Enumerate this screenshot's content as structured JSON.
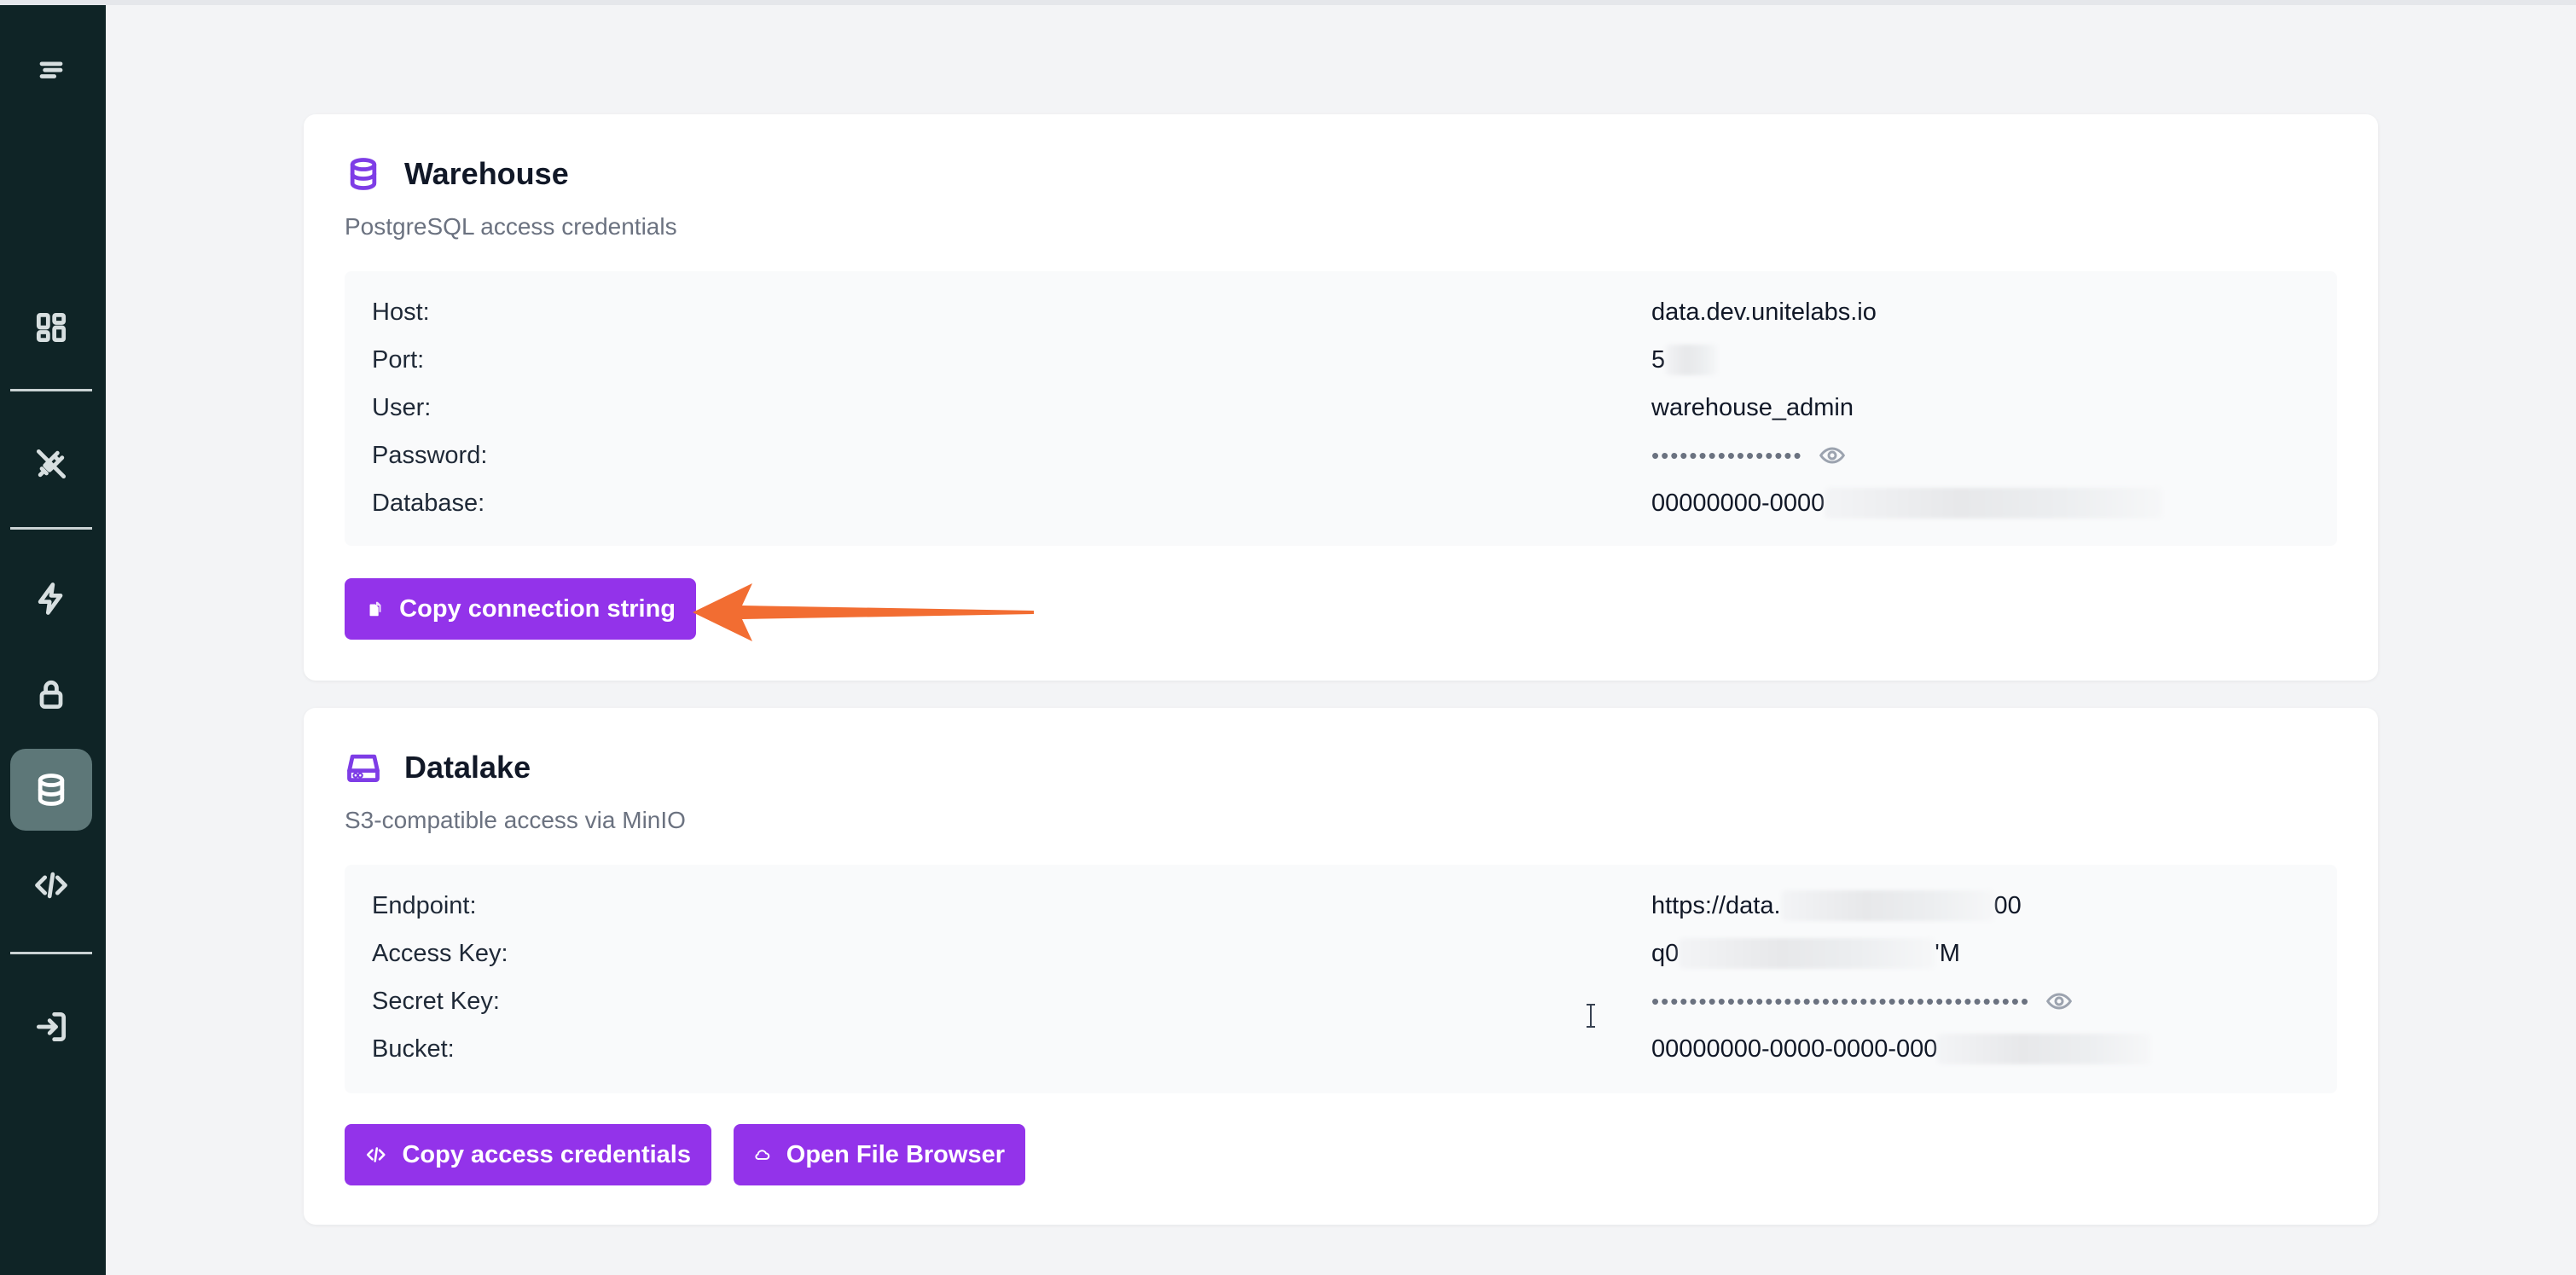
{
  "sidebar": {
    "items": [
      {
        "icon": "menu-icon"
      },
      {
        "icon": "dashboard-icon"
      },
      {
        "icon": "plug-icon"
      },
      {
        "icon": "lightning-icon"
      },
      {
        "icon": "lock-icon"
      },
      {
        "icon": "database-icon",
        "active": true
      },
      {
        "icon": "code-icon"
      },
      {
        "icon": "logout-icon"
      }
    ]
  },
  "warehouse": {
    "title": "Warehouse",
    "subtitle": "PostgreSQL access credentials",
    "host_label": "Host:",
    "host_value": "data.dev.unitelabs.io",
    "port_label": "Port:",
    "port_value": "5",
    "user_label": "User:",
    "user_value": "warehouse_admin",
    "password_label": "Password:",
    "password_value": "••••••••••••••••",
    "database_label": "Database:",
    "database_value": "00000000-0000",
    "copy_button": "Copy connection string"
  },
  "datalake": {
    "title": "Datalake",
    "subtitle": "S3-compatible access via MinIO",
    "endpoint_label": "Endpoint:",
    "endpoint_value_start": "https://data.",
    "endpoint_value_end": "00",
    "access_key_label": "Access Key:",
    "access_key_value_start": "q0",
    "access_key_value_end": "'M",
    "secret_key_label": "Secret Key:",
    "secret_key_value": "••••••••••••••••••••••••••••••••••••••••",
    "bucket_label": "Bucket:",
    "bucket_value": "00000000-0000-0000-000",
    "copy_button": "Copy access credentials",
    "browser_button": "Open File Browser"
  },
  "colors": {
    "sidebar_bg": "#0f2426",
    "accent": "#9333ea",
    "annotation_arrow": "#f26d32"
  }
}
